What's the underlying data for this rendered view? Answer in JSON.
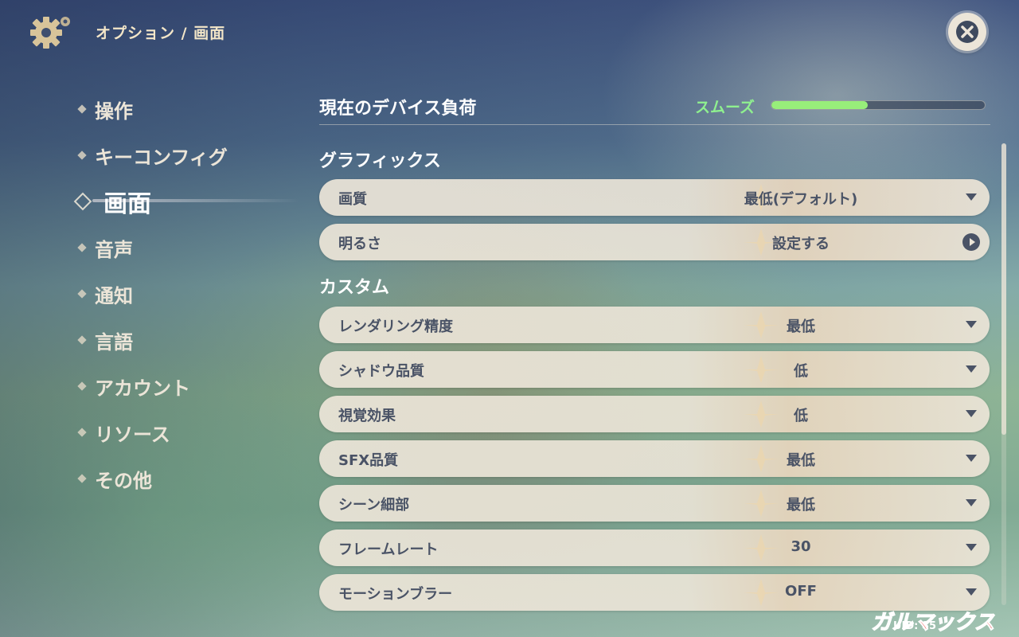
{
  "header": {
    "breadcrumb": "オプション / 画面"
  },
  "nav": {
    "items": [
      {
        "label": "操作",
        "active": false
      },
      {
        "label": "キーコンフィグ",
        "active": false
      },
      {
        "label": "画面",
        "active": true
      },
      {
        "label": "音声",
        "active": false
      },
      {
        "label": "通知",
        "active": false
      },
      {
        "label": "言語",
        "active": false
      },
      {
        "label": "アカウント",
        "active": false
      },
      {
        "label": "リソース",
        "active": false
      },
      {
        "label": "その他",
        "active": false
      }
    ]
  },
  "device_load": {
    "title": "現在のデバイス負荷",
    "status": "スムーズ",
    "level": 0.45,
    "color": "#98ee7a"
  },
  "graphics": {
    "section_title": "グラフィックス",
    "quality_label": "画質",
    "quality_value": "最低(デフォルト)",
    "brightness_label": "明るさ",
    "brightness_value": "設定する"
  },
  "custom": {
    "section_title": "カスタム",
    "rows": [
      {
        "label": "レンダリング精度",
        "value": "最低"
      },
      {
        "label": "シャドウ品質",
        "value": "低"
      },
      {
        "label": "視覚効果",
        "value": "低"
      },
      {
        "label": "SFX品質",
        "value": "最低"
      },
      {
        "label": "シーン細部",
        "value": "最低"
      },
      {
        "label": "フレームレート",
        "value": "30"
      },
      {
        "label": "モーションブラー",
        "value": "OFF"
      }
    ]
  },
  "footer": {
    "uid": "UID: 85",
    "watermark": "ガルマックス"
  },
  "colors": {
    "panel": "#ece5d8",
    "text_dark": "#4a5366",
    "accent_green": "#8ff08f"
  }
}
